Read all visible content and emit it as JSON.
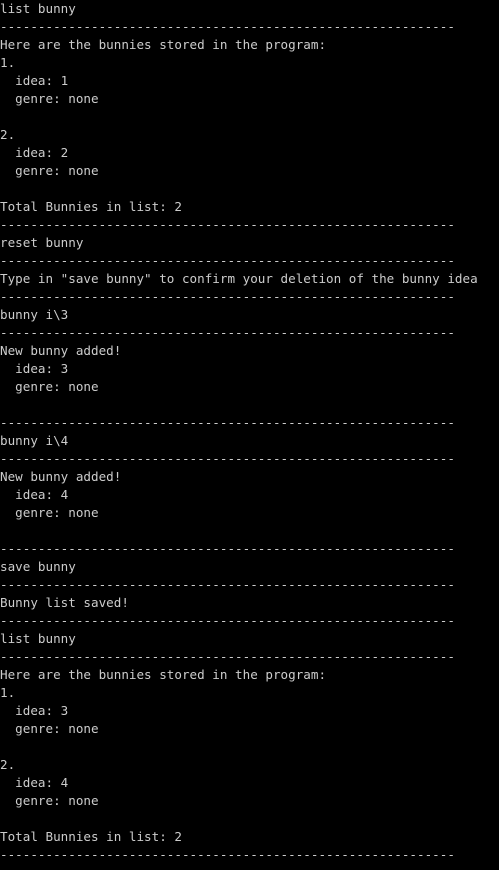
{
  "window": {
    "type": "terminal",
    "colors": {
      "background": "#000000",
      "text": "#cccccc"
    }
  },
  "console": {
    "lines": [
      "list bunny",
      "------------------------------------------------------------",
      "Here are the bunnies stored in the program:",
      "1.",
      "  idea: 1",
      "  genre: none",
      "",
      "2.",
      "  idea: 2",
      "  genre: none",
      "",
      "Total Bunnies in list: 2",
      "------------------------------------------------------------",
      "reset bunny",
      "------------------------------------------------------------",
      "Type in \"save bunny\" to confirm your deletion of the bunny idea",
      "------------------------------------------------------------",
      "bunny i\\3",
      "------------------------------------------------------------",
      "New bunny added!",
      "  idea: 3",
      "  genre: none",
      "",
      "------------------------------------------------------------",
      "bunny i\\4",
      "------------------------------------------------------------",
      "New bunny added!",
      "  idea: 4",
      "  genre: none",
      "",
      "------------------------------------------------------------",
      "save bunny",
      "------------------------------------------------------------",
      "Bunny list saved!",
      "------------------------------------------------------------",
      "list bunny",
      "------------------------------------------------------------",
      "Here are the bunnies stored in the program:",
      "1.",
      "  idea: 3",
      "  genre: none",
      "",
      "2.",
      "  idea: 4",
      "  genre: none",
      "",
      "Total Bunnies in list: 2",
      "------------------------------------------------------------"
    ]
  }
}
